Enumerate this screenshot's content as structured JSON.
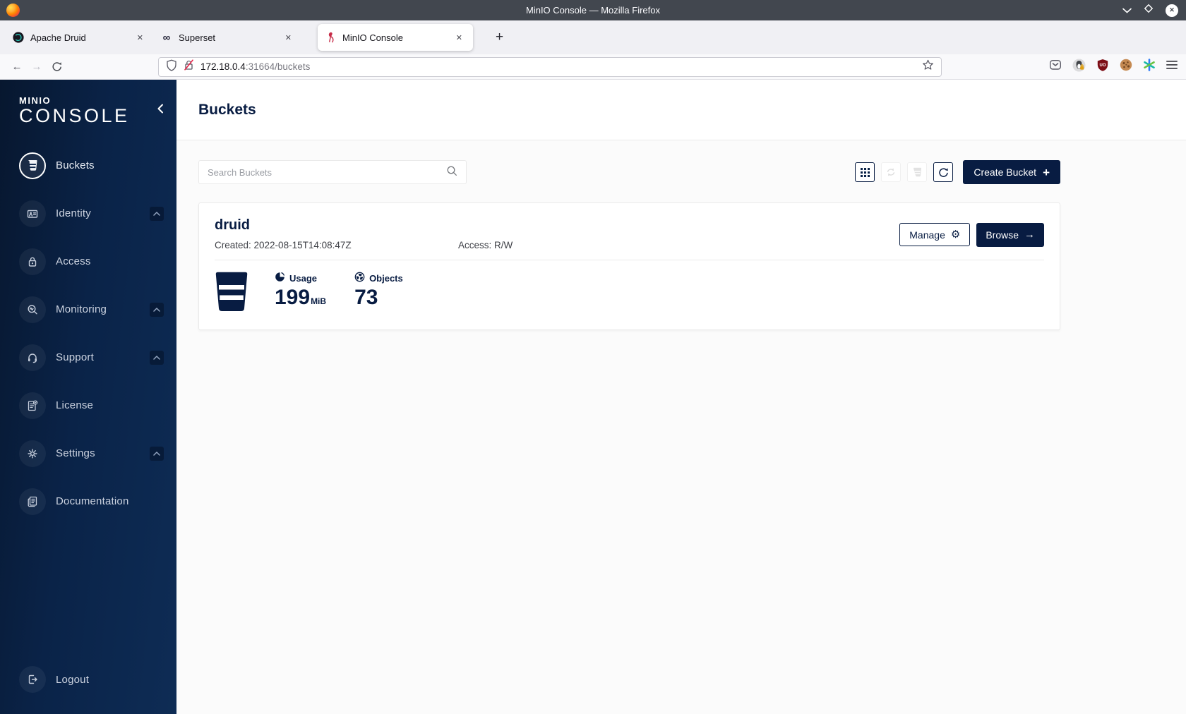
{
  "window": {
    "title": "MinIO Console — Mozilla Firefox"
  },
  "browser": {
    "tabs": [
      {
        "label": "Apache Druid"
      },
      {
        "label": "Superset"
      },
      {
        "label": "MinIO Console"
      }
    ],
    "url": {
      "host": "172.18.0.4",
      "rest": ":31664/buckets"
    }
  },
  "sidebar": {
    "logo_line1": "MINIO",
    "logo_line2": "CONSOLE",
    "items": [
      {
        "label": "Buckets"
      },
      {
        "label": "Identity"
      },
      {
        "label": "Access"
      },
      {
        "label": "Monitoring"
      },
      {
        "label": "Support"
      },
      {
        "label": "License"
      },
      {
        "label": "Settings"
      },
      {
        "label": "Documentation"
      }
    ],
    "logout_label": "Logout"
  },
  "main": {
    "page_title": "Buckets",
    "search_placeholder": "Search Buckets",
    "create_button_label": "Create Bucket",
    "bucket_card": {
      "name": "druid",
      "created": "Created: 2022-08-15T14:08:47Z",
      "access": "Access: R/W",
      "manage_label": "Manage",
      "browse_label": "Browse",
      "usage_label": "Usage",
      "usage_value": "199",
      "usage_unit": "MiB",
      "objects_label": "Objects",
      "objects_value": "73"
    }
  },
  "icons": {
    "tab_close": "✕",
    "window_close": "✕",
    "new_tab": "+",
    "nav_back": "←",
    "nav_forward": "→",
    "superset_infinity": "∞",
    "gear": "⚙",
    "arrow_right": "→",
    "plus": "+"
  },
  "colors": {
    "navy": "#081C42",
    "sidebar_gradient_start": "#07172f",
    "sidebar_gradient_end": "#0e2c55",
    "minio_red": "#C72C48",
    "content_background": "#fbfbfb"
  }
}
